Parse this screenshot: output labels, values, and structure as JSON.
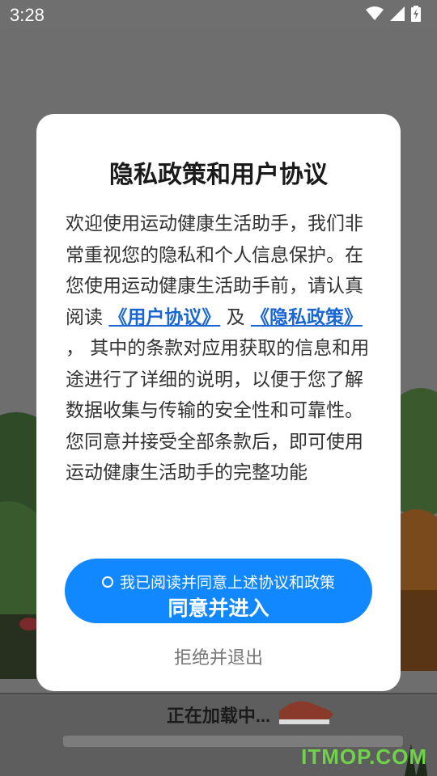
{
  "status_bar": {
    "time": "3:28",
    "icons": [
      "wifi-icon",
      "signal-icon",
      "battery-charging-icon"
    ]
  },
  "dialog": {
    "title": "隐私政策和用户协议",
    "body_part1": "欢迎使用运动健康生活助手，我们非常重视您的隐私和个人信息保护。在您使用运动健康生活助手前，请认真阅读",
    "user_agreement_link": "《用户协议》",
    "and_text": "及",
    "privacy_policy_link": "《隐私政策》",
    "body_part2": "， 其中的条款对应用获取的信息和用途进行了详细的说明，以便于您了解数据收集与传输的安全性和可靠性。您同意并接受全部条款后，即可使用运动健康生活助手的完整功能",
    "checkbox_label": "我已阅读并同意上述协议和政策",
    "agree_button_label": "同意并进入",
    "reject_button_label": "拒绝并退出"
  },
  "background": {
    "loading_text": "正在加载中...",
    "watermark": "ITMOP.COM"
  },
  "colors": {
    "accent": "#1188ff",
    "link": "#1a66d4",
    "overlay_bg": "#6f6f6f"
  }
}
